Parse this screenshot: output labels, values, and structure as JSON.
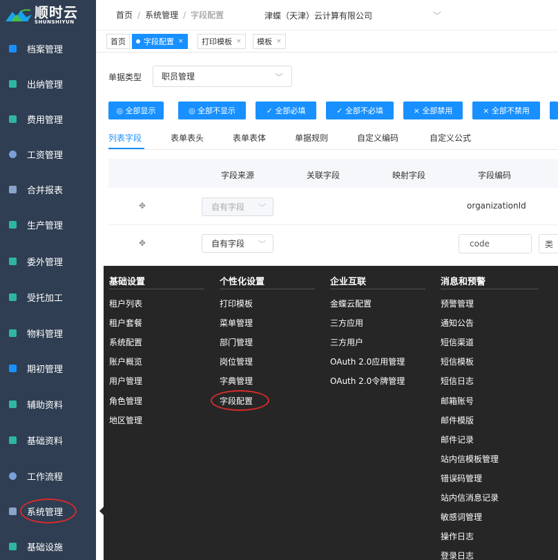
{
  "brand": {
    "name_cn": "顺时云",
    "name_en": "SHUNSHIYUN"
  },
  "sidebar": {
    "items": [
      {
        "label": "档案管理",
        "color": "#1890ff"
      },
      {
        "label": "出纳管理",
        "color": "#2fb6a0"
      },
      {
        "label": "费用管理",
        "color": "#2fb6a0"
      },
      {
        "label": "工资管理",
        "color": "#7aa0d8"
      },
      {
        "label": "合并报表",
        "color": "#8aa3c9"
      },
      {
        "label": "生产管理",
        "color": "#2fb6a0"
      },
      {
        "label": "委外管理",
        "color": "#2fb6a0"
      },
      {
        "label": "受托加工",
        "color": "#2fb6a0"
      },
      {
        "label": "物料管理",
        "color": "#2fb6a0"
      },
      {
        "label": "期初管理",
        "color": "#1890ff"
      },
      {
        "label": "辅助资料",
        "color": "#2fb6a0"
      },
      {
        "label": "基础资料",
        "color": "#2fb6a0"
      },
      {
        "label": "工作流程",
        "color": "#7aa0d8"
      },
      {
        "label": "系统管理",
        "color": "#8aa3c9"
      },
      {
        "label": "基础设施",
        "color": "#2fb6a0"
      }
    ]
  },
  "header": {
    "breadcrumb": [
      "首页",
      "系统管理",
      "字段配置"
    ],
    "separator": "/",
    "company": "津蝶（天津）云计算有限公司"
  },
  "tabs": [
    {
      "label": "首页",
      "closable": false,
      "active": false
    },
    {
      "label": "字段配置",
      "closable": true,
      "active": true
    },
    {
      "label": "打印模板",
      "closable": true,
      "active": false
    },
    {
      "label": "模板",
      "closable": true,
      "active": false
    }
  ],
  "tab_close_glyph": "×",
  "doc_type": {
    "label": "单据类型",
    "value": "职员管理"
  },
  "actions": [
    {
      "label": "全部显示",
      "icon": "eye-icon",
      "glyph": "◎"
    },
    {
      "label": "全部不显示",
      "icon": "eye-off-icon",
      "glyph": "◎"
    },
    {
      "label": "全部必填",
      "icon": "check-icon",
      "glyph": "✓"
    },
    {
      "label": "全部不必填",
      "icon": "check-icon",
      "glyph": "✓"
    },
    {
      "label": "全部禁用",
      "icon": "close-icon",
      "glyph": "×"
    },
    {
      "label": "全部不禁用",
      "icon": "close-icon",
      "glyph": "×"
    }
  ],
  "subtabs": [
    "列表字段",
    "表单表头",
    "表单表体",
    "单据规则",
    "自定义编码",
    "自定义公式"
  ],
  "table": {
    "headers": [
      "字段来源",
      "关联字段",
      "映射字段",
      "字段编码"
    ],
    "rows": [
      {
        "source": "自有字段",
        "code": "organizationId",
        "disabled": true
      },
      {
        "source": "自有字段",
        "code": "code",
        "disabled": false,
        "extra": "类"
      }
    ]
  },
  "menu_panel": {
    "columns": [
      {
        "title": "基础设置",
        "items": [
          "租户列表",
          "租户套餐",
          "系统配置",
          "账户概览",
          "用户管理",
          "角色管理",
          "地区管理"
        ]
      },
      {
        "title": "个性化设置",
        "items": [
          "打印模板",
          "菜单管理",
          "部门管理",
          "岗位管理",
          "字典管理",
          "字段配置"
        ]
      },
      {
        "title": "企业互联",
        "items": [
          "金蝶云配置",
          "三方应用",
          "三方用户",
          "OAuth 2.0应用管理",
          "OAuth 2.0令牌管理"
        ]
      },
      {
        "title": "消息和预警",
        "items": [
          "预警管理",
          "通知公告",
          "短信渠道",
          "短信模板",
          "短信日志",
          "邮箱账号",
          "邮件模版",
          "邮件记录",
          "站内信模板管理",
          "错误码管理",
          "站内信消息记录",
          "敏感词管理",
          "操作日志",
          "登录日志"
        ]
      }
    ]
  },
  "colors": {
    "accent": "#1890ff",
    "sidebar": "#2f3e52",
    "panel": "#262626",
    "highlight": "#d92b2b"
  }
}
